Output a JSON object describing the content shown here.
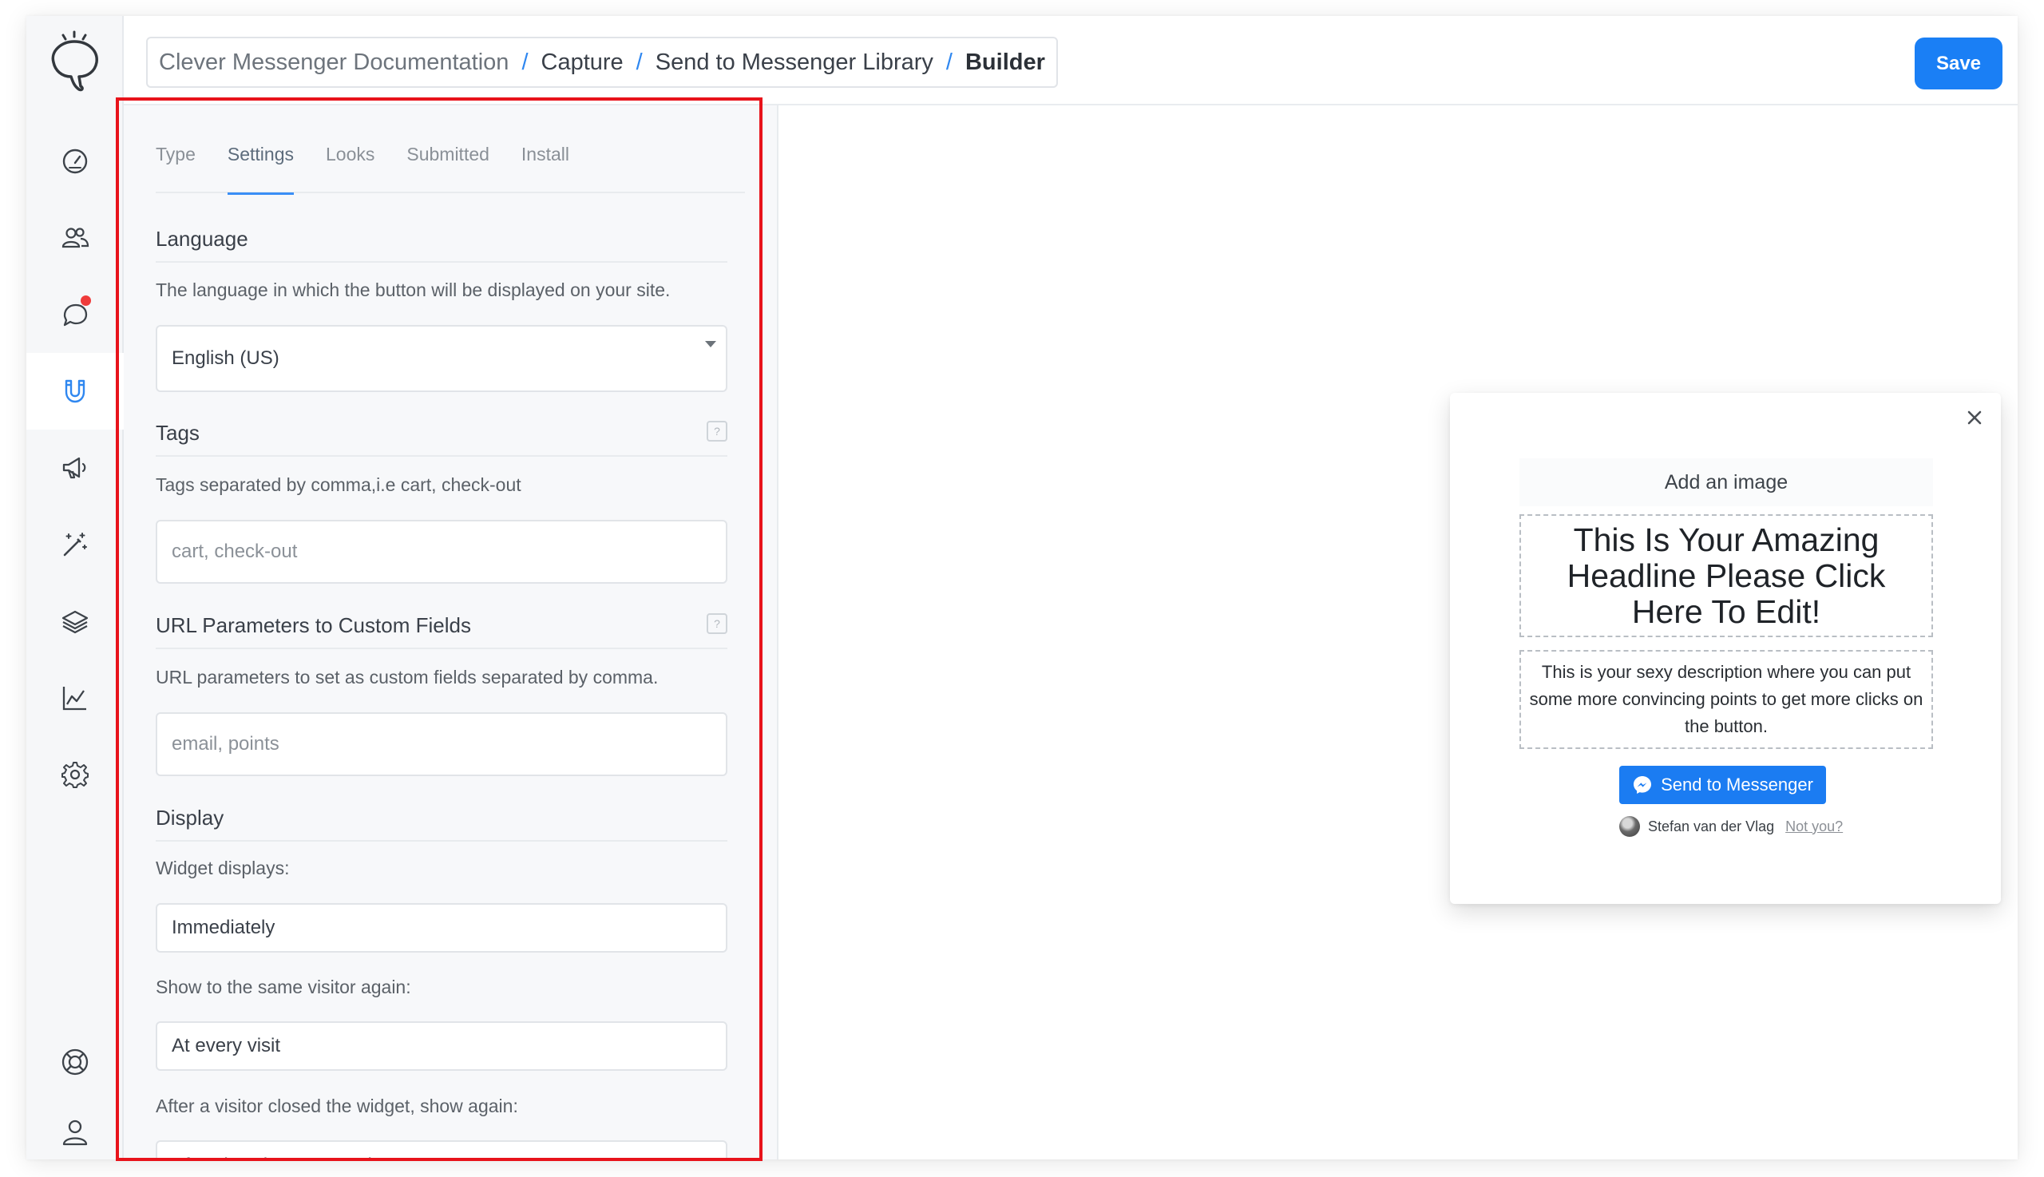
{
  "breadcrumb": [
    "Clever Messenger Documentation",
    "Capture",
    "Send to Messenger Library",
    "Builder"
  ],
  "header": {
    "save_label": "Save"
  },
  "sidebar": {
    "items": [
      {
        "icon": "dashboard-gauge-icon"
      },
      {
        "icon": "users-icon"
      },
      {
        "icon": "chat-bubble-icon",
        "badge": true
      },
      {
        "icon": "magnet-icon",
        "active": true
      },
      {
        "icon": "megaphone-icon"
      },
      {
        "icon": "magic-wand-icon"
      },
      {
        "icon": "layers-icon"
      },
      {
        "icon": "analytics-chart-icon"
      },
      {
        "icon": "gear-icon"
      },
      {
        "icon": "help-lifebuoy-icon"
      },
      {
        "icon": "user-profile-icon"
      }
    ]
  },
  "panel": {
    "tabs": [
      {
        "label": "Type"
      },
      {
        "label": "Settings",
        "active": true
      },
      {
        "label": "Looks"
      },
      {
        "label": "Submitted"
      },
      {
        "label": "Install"
      }
    ],
    "language": {
      "title": "Language",
      "description": "The language in which the button will be displayed on your site.",
      "value": "English (US)"
    },
    "tags": {
      "title": "Tags",
      "help": "?",
      "description": "Tags separated by comma,i.e cart, check-out",
      "placeholder": "cart, check-out"
    },
    "url_params": {
      "title": "URL Parameters to Custom Fields",
      "help": "?",
      "description": "URL parameters to set as custom fields separated by comma.",
      "placeholder": "email, points"
    },
    "display": {
      "title": "Display",
      "widget_displays_label": "Widget displays:",
      "widget_displays_value": "Immediately",
      "show_again_label": "Show to the same visitor again:",
      "show_again_value": "At every visit",
      "after_close_label": "After a visitor closed the widget, show again:",
      "after_close_value": "After days have passed:"
    }
  },
  "widget": {
    "add_image": "Add an image",
    "headline": "This Is Your Amazing Headline Please Click Here To Edit!",
    "description": "This is your sexy description where you can put some more convincing points to get more clicks on the button.",
    "button_label": "Send to Messenger",
    "user_name": "Stefan van der Vlag",
    "not_you": "Not you?"
  },
  "colors": {
    "accent": "#1a7ff5",
    "highlight": "#e8131b",
    "badge": "#ef3b3b"
  }
}
